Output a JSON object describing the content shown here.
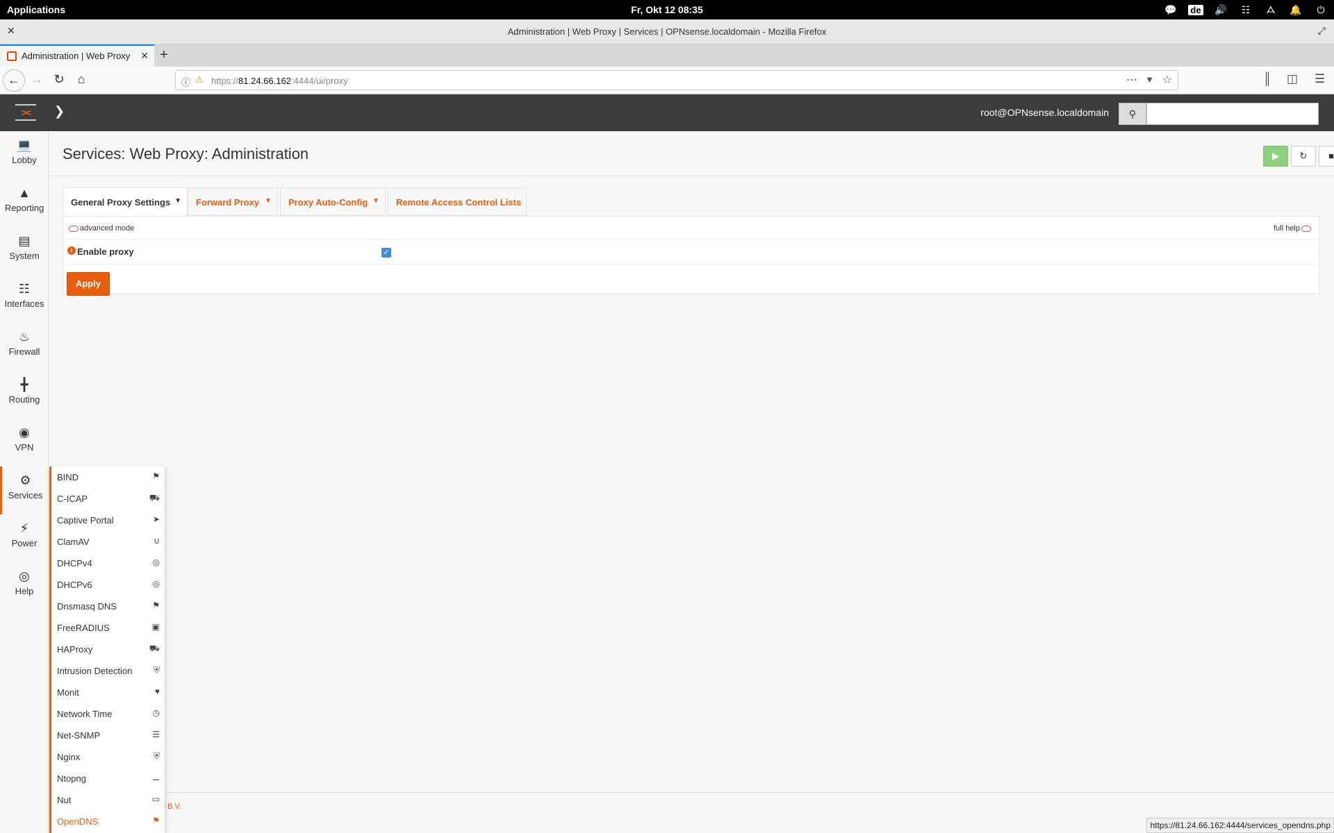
{
  "topbar": {
    "applications": "Applications",
    "datetime": "Fr, Okt 12   08:35",
    "lang": "de",
    "tray_icons": [
      "chat-icon",
      "volume-icon",
      "network-icon",
      "bluetooth-icon",
      "bell-icon",
      "power-icon"
    ]
  },
  "window": {
    "title": "Administration | Web Proxy | Services | OPNsense.localdomain - Mozilla Firefox"
  },
  "browser": {
    "tab_label": "Administration | Web Proxy |",
    "url_prefix": "https://",
    "url_host": "81.24.66.162",
    "url_rest": ":4444/ui/proxy",
    "status_url": "https://81.24.66.162:4444/services_opendns.php"
  },
  "header": {
    "user": "root@OPNsense.localdomain",
    "search_placeholder": ""
  },
  "sidebar": {
    "items": [
      {
        "label": "Lobby",
        "icon": "laptop-icon"
      },
      {
        "label": "Reporting",
        "icon": "area-chart-icon"
      },
      {
        "label": "System",
        "icon": "server-icon"
      },
      {
        "label": "Interfaces",
        "icon": "sitemap-icon"
      },
      {
        "label": "Firewall",
        "icon": "fire-icon"
      },
      {
        "label": "Routing",
        "icon": "signpost-icon"
      },
      {
        "label": "VPN",
        "icon": "globe-icon"
      },
      {
        "label": "Services",
        "icon": "cog-icon"
      },
      {
        "label": "Power",
        "icon": "plug-icon"
      },
      {
        "label": "Help",
        "icon": "life-ring-icon"
      }
    ]
  },
  "services_menu": {
    "items": [
      {
        "label": "BIND",
        "icon": "tags-icon"
      },
      {
        "label": "C-ICAP",
        "icon": "ambulance-icon"
      },
      {
        "label": "Captive Portal",
        "icon": "paper-plane-icon"
      },
      {
        "label": "ClamAV",
        "icon": "stethoscope-icon"
      },
      {
        "label": "DHCPv4",
        "icon": "bullseye-icon"
      },
      {
        "label": "DHCPv6",
        "icon": "bullseye-icon"
      },
      {
        "label": "Dnsmasq DNS",
        "icon": "tags-icon"
      },
      {
        "label": "FreeRADIUS",
        "icon": "id-card-icon"
      },
      {
        "label": "HAProxy",
        "icon": "truck-icon"
      },
      {
        "label": "Intrusion Detection",
        "icon": "shield-icon"
      },
      {
        "label": "Monit",
        "icon": "heartbeat-icon"
      },
      {
        "label": "Network Time",
        "icon": "clock-icon"
      },
      {
        "label": "Net-SNMP",
        "icon": "database-icon"
      },
      {
        "label": "Nginx",
        "icon": "shield-icon"
      },
      {
        "label": "Ntopng",
        "icon": "binoculars-icon"
      },
      {
        "label": "Nut",
        "icon": "battery-icon"
      },
      {
        "label": "OpenDNS",
        "icon": "tags-icon"
      }
    ]
  },
  "page": {
    "title": "Services: Web Proxy: Administration",
    "tabs": [
      {
        "label": "General Proxy Settings"
      },
      {
        "label": "Forward Proxy"
      },
      {
        "label": "Proxy Auto-Config"
      },
      {
        "label": "Remote Access Control Lists"
      }
    ],
    "advanced_mode": "advanced mode",
    "full_help": "full help",
    "enable_proxy_label": "Enable proxy",
    "enable_proxy_checked": true,
    "apply_label": "Apply",
    "footer_text": "o B.V."
  },
  "colors": {
    "accent": "#e95d0c",
    "header_bg": "#3c3c3c",
    "play_green": "#8fd17e"
  }
}
